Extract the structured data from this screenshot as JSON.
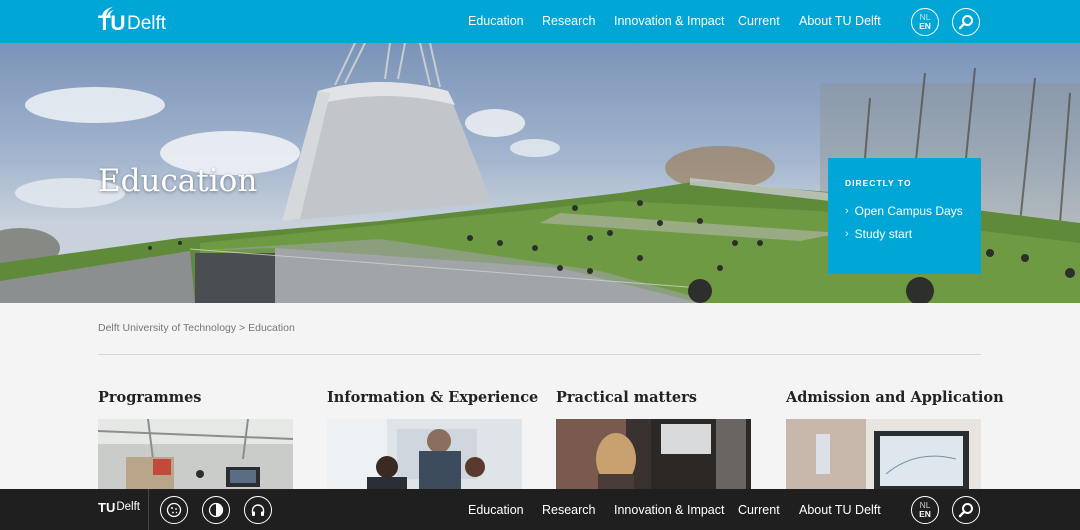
{
  "header": {
    "logo_tu": "TU",
    "logo_delft": "Delft",
    "nav": [
      "Education",
      "Research",
      "Innovation & Impact",
      "Current",
      "About TU Delft"
    ],
    "lang_inactive": "NL",
    "lang_active": "EN"
  },
  "hero": {
    "title": "Education",
    "directly_to": {
      "heading": "DIRECTLY TO",
      "links": [
        "Open Campus Days",
        "Study start"
      ]
    }
  },
  "breadcrumb": {
    "root": "Delft University of Technology",
    "separator": ">",
    "current": "Education"
  },
  "cards": [
    {
      "title": "Programmes"
    },
    {
      "title": "Information & Experience"
    },
    {
      "title": "Practical matters"
    },
    {
      "title": "Admission and Application"
    }
  ],
  "footer_bar": {
    "logo_tu": "TU",
    "logo_delft": "Delft",
    "nav": [
      "Education",
      "Research",
      "Innovation & Impact",
      "Current",
      "About TU Delft"
    ],
    "lang_inactive": "NL",
    "lang_active": "EN"
  },
  "colors": {
    "brand": "#00a6d6",
    "footer": "#1f1f1f"
  }
}
